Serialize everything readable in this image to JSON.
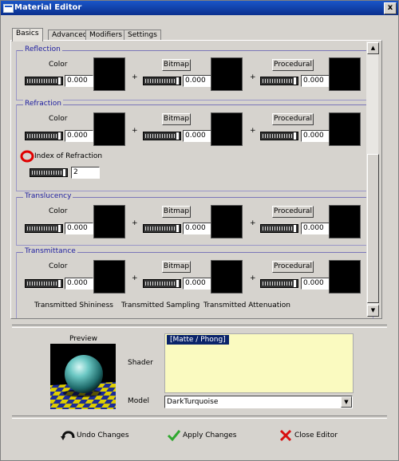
{
  "window": {
    "title": "Material Editor",
    "close_glyph": "x"
  },
  "tabs": [
    {
      "label": "Basics",
      "active": true
    },
    {
      "label": "Advanced",
      "active": false
    },
    {
      "label": "Modifiers",
      "active": false
    },
    {
      "label": "Settings",
      "active": false
    }
  ],
  "groups": {
    "reflection": {
      "title": "Reflection",
      "color_label": "Color",
      "bitmap_label": "Bitmap",
      "procedural_label": "Procedural",
      "values": [
        "0.000",
        "0.000",
        "0.000"
      ]
    },
    "refraction": {
      "title": "Refraction",
      "color_label": "Color",
      "bitmap_label": "Bitmap",
      "procedural_label": "Procedural",
      "values": [
        "0.000",
        "0.000",
        "0.000"
      ],
      "ior_label": "Index of Refraction",
      "ior_value": "2"
    },
    "translucency": {
      "title": "Translucency",
      "color_label": "Color",
      "bitmap_label": "Bitmap",
      "procedural_label": "Procedural",
      "values": [
        "0.000",
        "0.000",
        "0.000"
      ]
    },
    "transmittance": {
      "title": "Transmittance",
      "color_label": "Color",
      "bitmap_label": "Bitmap",
      "procedural_label": "Procedural",
      "values": [
        "0.000",
        "0.000",
        "0.000"
      ]
    }
  },
  "transmitted": {
    "shininess": "Transmitted Shininess",
    "sampling": "Transmitted Sampling",
    "attenuation": "Transmitted Attenuation"
  },
  "plus_glyph": "+",
  "preview": {
    "label": "Preview"
  },
  "shader": {
    "label": "Shader",
    "selected": "[Matte / Phong]"
  },
  "model": {
    "label": "Model",
    "value": "DarkTurquoise"
  },
  "actions": {
    "undo": "Undo Changes",
    "apply": "Apply Changes",
    "close": "Close Editor"
  },
  "colors": {
    "title_bar": "#0a2f8e",
    "group_title": "#2020a0",
    "shader_bg": "#fafac0",
    "highlight": "#0a246a",
    "ior_marker": "#e00000"
  }
}
